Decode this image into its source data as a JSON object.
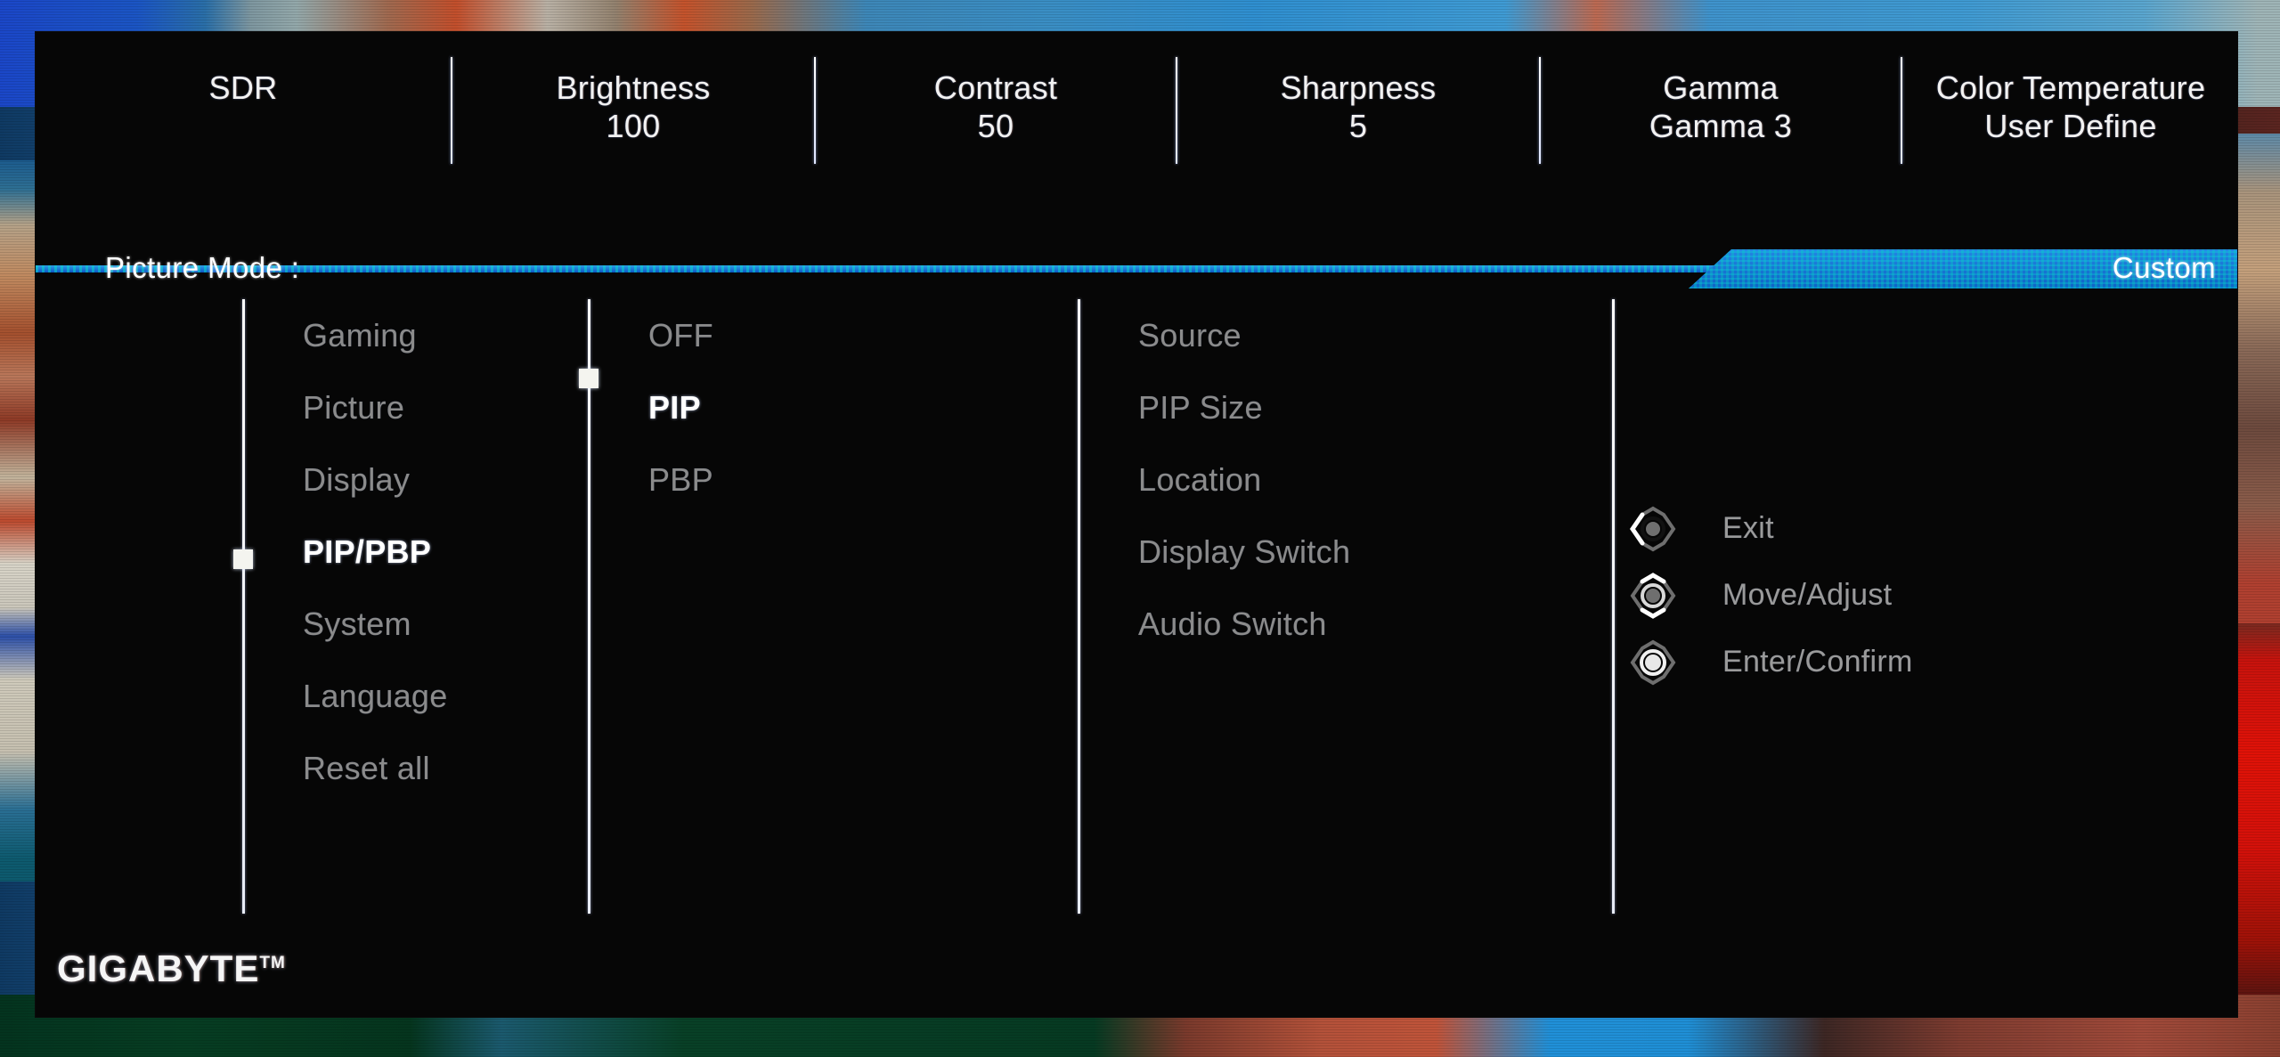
{
  "osd": {
    "brand": "GIGABYTE",
    "brand_tm": "TM",
    "accent_color": "#1878d8",
    "highlight_color": "#ffffff",
    "dim_color": "#8b8b8b"
  },
  "header": {
    "items": [
      {
        "label": "SDR",
        "value": ""
      },
      {
        "label": "Brightness",
        "value": "100"
      },
      {
        "label": "Contrast",
        "value": "50"
      },
      {
        "label": "Sharpness",
        "value": "5"
      },
      {
        "label": "Gamma",
        "value": "Gamma 3"
      },
      {
        "label": "Color Temperature",
        "value": "User Define"
      }
    ]
  },
  "picture_mode": {
    "label": "Picture Mode  :",
    "value": "Custom"
  },
  "columns": {
    "main_menu": {
      "items": [
        {
          "label": "Gaming",
          "selected": false
        },
        {
          "label": "Picture",
          "selected": false
        },
        {
          "label": "Display",
          "selected": false
        },
        {
          "label": "PIP/PBP",
          "selected": true
        },
        {
          "label": "System",
          "selected": false
        },
        {
          "label": "Language",
          "selected": false
        },
        {
          "label": "Reset all",
          "selected": false
        }
      ]
    },
    "mode_menu": {
      "items": [
        {
          "label": "OFF",
          "selected": false
        },
        {
          "label": "PIP",
          "selected": true
        },
        {
          "label": "PBP",
          "selected": false
        }
      ]
    },
    "pip_settings": {
      "items": [
        {
          "label": "Source",
          "selected": false
        },
        {
          "label": "PIP Size",
          "selected": false
        },
        {
          "label": "Location",
          "selected": false
        },
        {
          "label": "Display Switch",
          "selected": false
        },
        {
          "label": "Audio Switch",
          "selected": false
        }
      ]
    }
  },
  "legend": {
    "items": [
      {
        "icon": "joystick-left-icon",
        "label": "Exit"
      },
      {
        "icon": "joystick-updown-icon",
        "label": "Move/Adjust"
      },
      {
        "icon": "joystick-press-icon",
        "label": "Enter/Confirm"
      }
    ]
  }
}
